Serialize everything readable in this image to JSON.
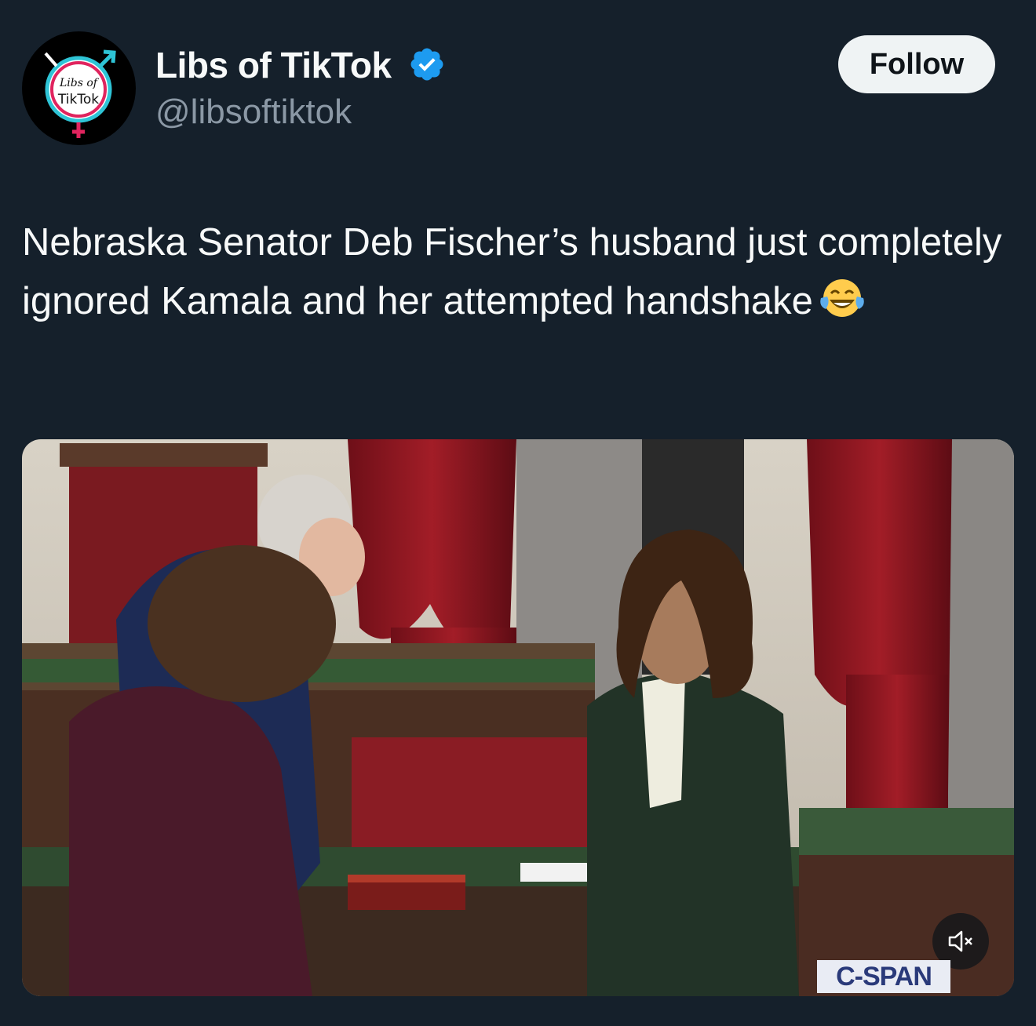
{
  "author": {
    "display_name": "Libs of TikTok",
    "handle": "@libsoftiktok",
    "verified": true,
    "avatar_text": "Libs of TikTok"
  },
  "actions": {
    "follow_label": "Follow"
  },
  "tweet": {
    "text": "Nebraska Senator Deb Fischer’s husband just completely ignored Kamala and her attempted handshake",
    "emoji": "face-with-tears-of-joy"
  },
  "media": {
    "type": "video",
    "watermark": "C-SPAN",
    "muted": true
  },
  "colors": {
    "background": "#15202b",
    "verified_badge": "#1d9bf0",
    "follow_button": "#eff3f4"
  }
}
